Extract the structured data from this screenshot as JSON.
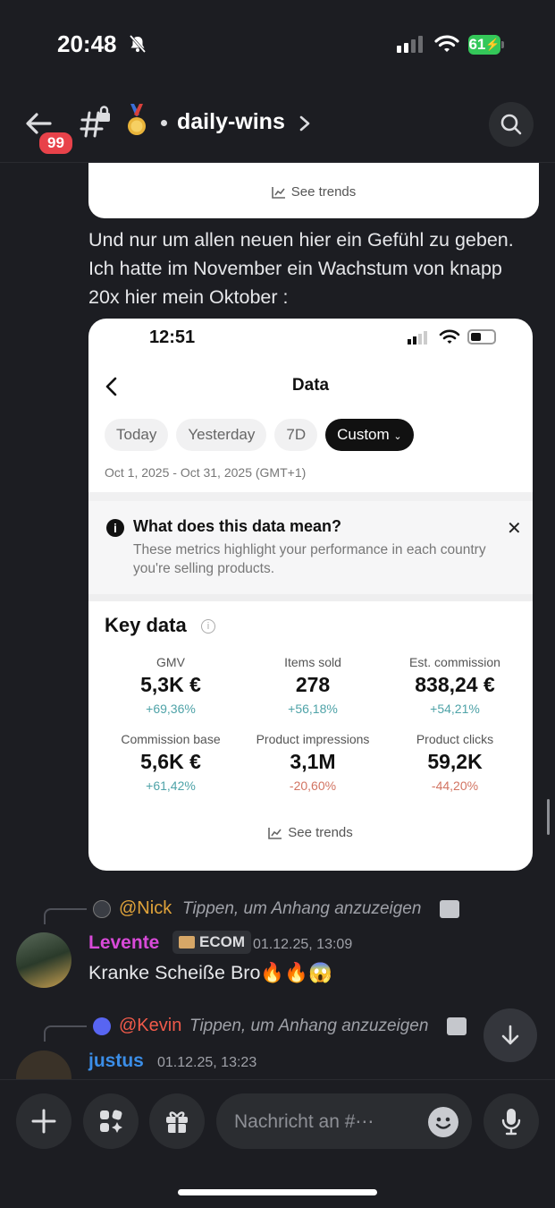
{
  "status_bar": {
    "time": "20:48",
    "battery": "61"
  },
  "header": {
    "badge": "99",
    "channel_name": "daily-wins"
  },
  "card_top": {
    "see_trends": "See trends"
  },
  "message_text": "Und nur um allen neuen hier ein Gefühl zu geben. Ich hatte im November ein Wachstum von knapp 20x hier mein Oktober :",
  "screenshot": {
    "time": "12:51",
    "title": "Data",
    "pills": [
      "Today",
      "Yesterday",
      "7D",
      "Custom"
    ],
    "date_range": "Oct 1, 2025 - Oct 31, 2025 (GMT+1)",
    "info_title": "What does this data mean?",
    "info_desc": "These metrics highlight your performance in each country you're selling products.",
    "key_title": "Key data",
    "metrics": [
      {
        "label": "GMV",
        "value": "5,3K €",
        "change": "+69,36%"
      },
      {
        "label": "Items sold",
        "value": "278",
        "change": "+56,18%"
      },
      {
        "label": "Est. commission",
        "value": "838,24 €",
        "change": "+54,21%"
      },
      {
        "label": "Commission base",
        "value": "5,6K €",
        "change": "+61,42%"
      },
      {
        "label": "Product impressions",
        "value": "3,1M",
        "change": "-20,60%"
      },
      {
        "label": "Product clicks",
        "value": "59,2K",
        "change": "-44,20%"
      }
    ],
    "see_trends": "See trends"
  },
  "reply1": {
    "name": "@Nick",
    "hint": "Tippen, um Anhang anzuzeigen"
  },
  "message1": {
    "user": "Levente",
    "tag": "ECOM",
    "time": "01.12.25, 13:09",
    "text": "Kranke Scheiße Bro🔥🔥😱"
  },
  "reply2": {
    "name": "@Kevin",
    "hint": "Tippen, um Anhang anzuzeigen"
  },
  "message2": {
    "user": "justus",
    "time": "01.12.25, 13:23"
  },
  "composer": {
    "placeholder": "Nachricht an #⋯"
  },
  "colors": {
    "accent_red": "#e8424a",
    "nick": "#e0a33a",
    "levente": "#d84ad8",
    "kevin": "#f05a4a",
    "justus": "#3b8ee8",
    "positive": "#4fa3a8",
    "negative": "#d27462"
  }
}
